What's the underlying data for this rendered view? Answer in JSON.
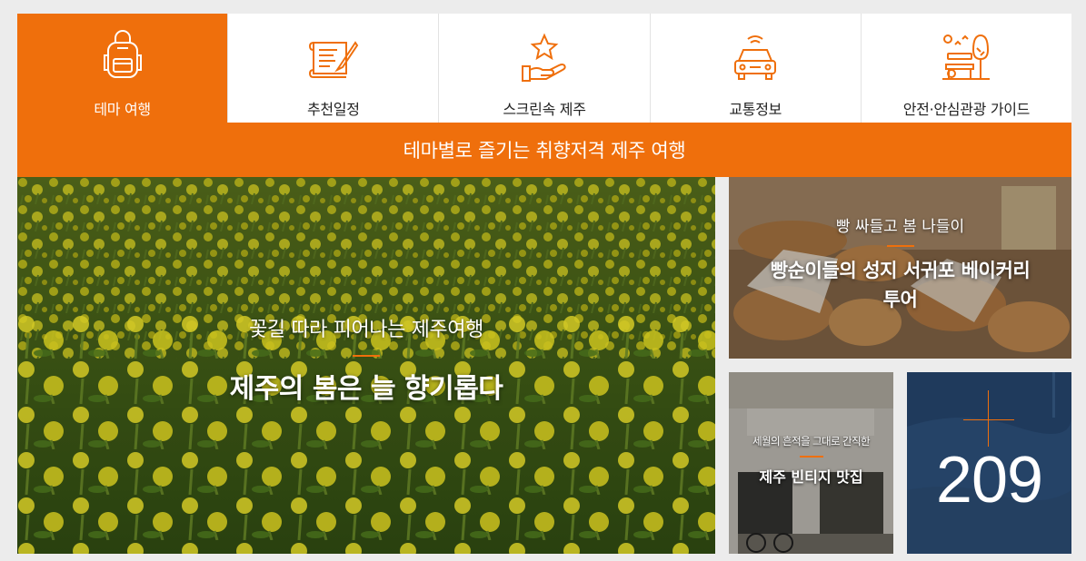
{
  "tabs": [
    {
      "label": "테마 여행",
      "icon": "backpack-icon",
      "active": true
    },
    {
      "label": "추천일정",
      "icon": "itinerary-icon",
      "active": false
    },
    {
      "label": "스크린속 제주",
      "icon": "star-hand-icon",
      "active": false
    },
    {
      "label": "교통정보",
      "icon": "car-icon",
      "active": false
    },
    {
      "label": "안전·안심관광 가이드",
      "icon": "park-bench-icon",
      "active": false
    }
  ],
  "banner": {
    "text": "테마별로 즐기는 취향저격 제주 여행"
  },
  "feature": {
    "subtitle": "꽃길 따라 피어나는 제주여행",
    "title": "제주의 봄은 늘 향기롭다"
  },
  "cards": {
    "bakery": {
      "subtitle": "빵 싸들고 봄 나들이",
      "title_line1": "빵순이들의 성지 서귀포 베이커리",
      "title_line2": "투어"
    },
    "vintage": {
      "subtitle": "세월의 흔적을 그대로 간직한",
      "title": "제주 빈티지 맛집"
    },
    "counter": {
      "value": "209"
    }
  },
  "colors": {
    "accent": "#ef6f0c",
    "tab_bg": "#ffffff",
    "page_bg": "#ececec",
    "counter_bg": "#1d3557"
  }
}
